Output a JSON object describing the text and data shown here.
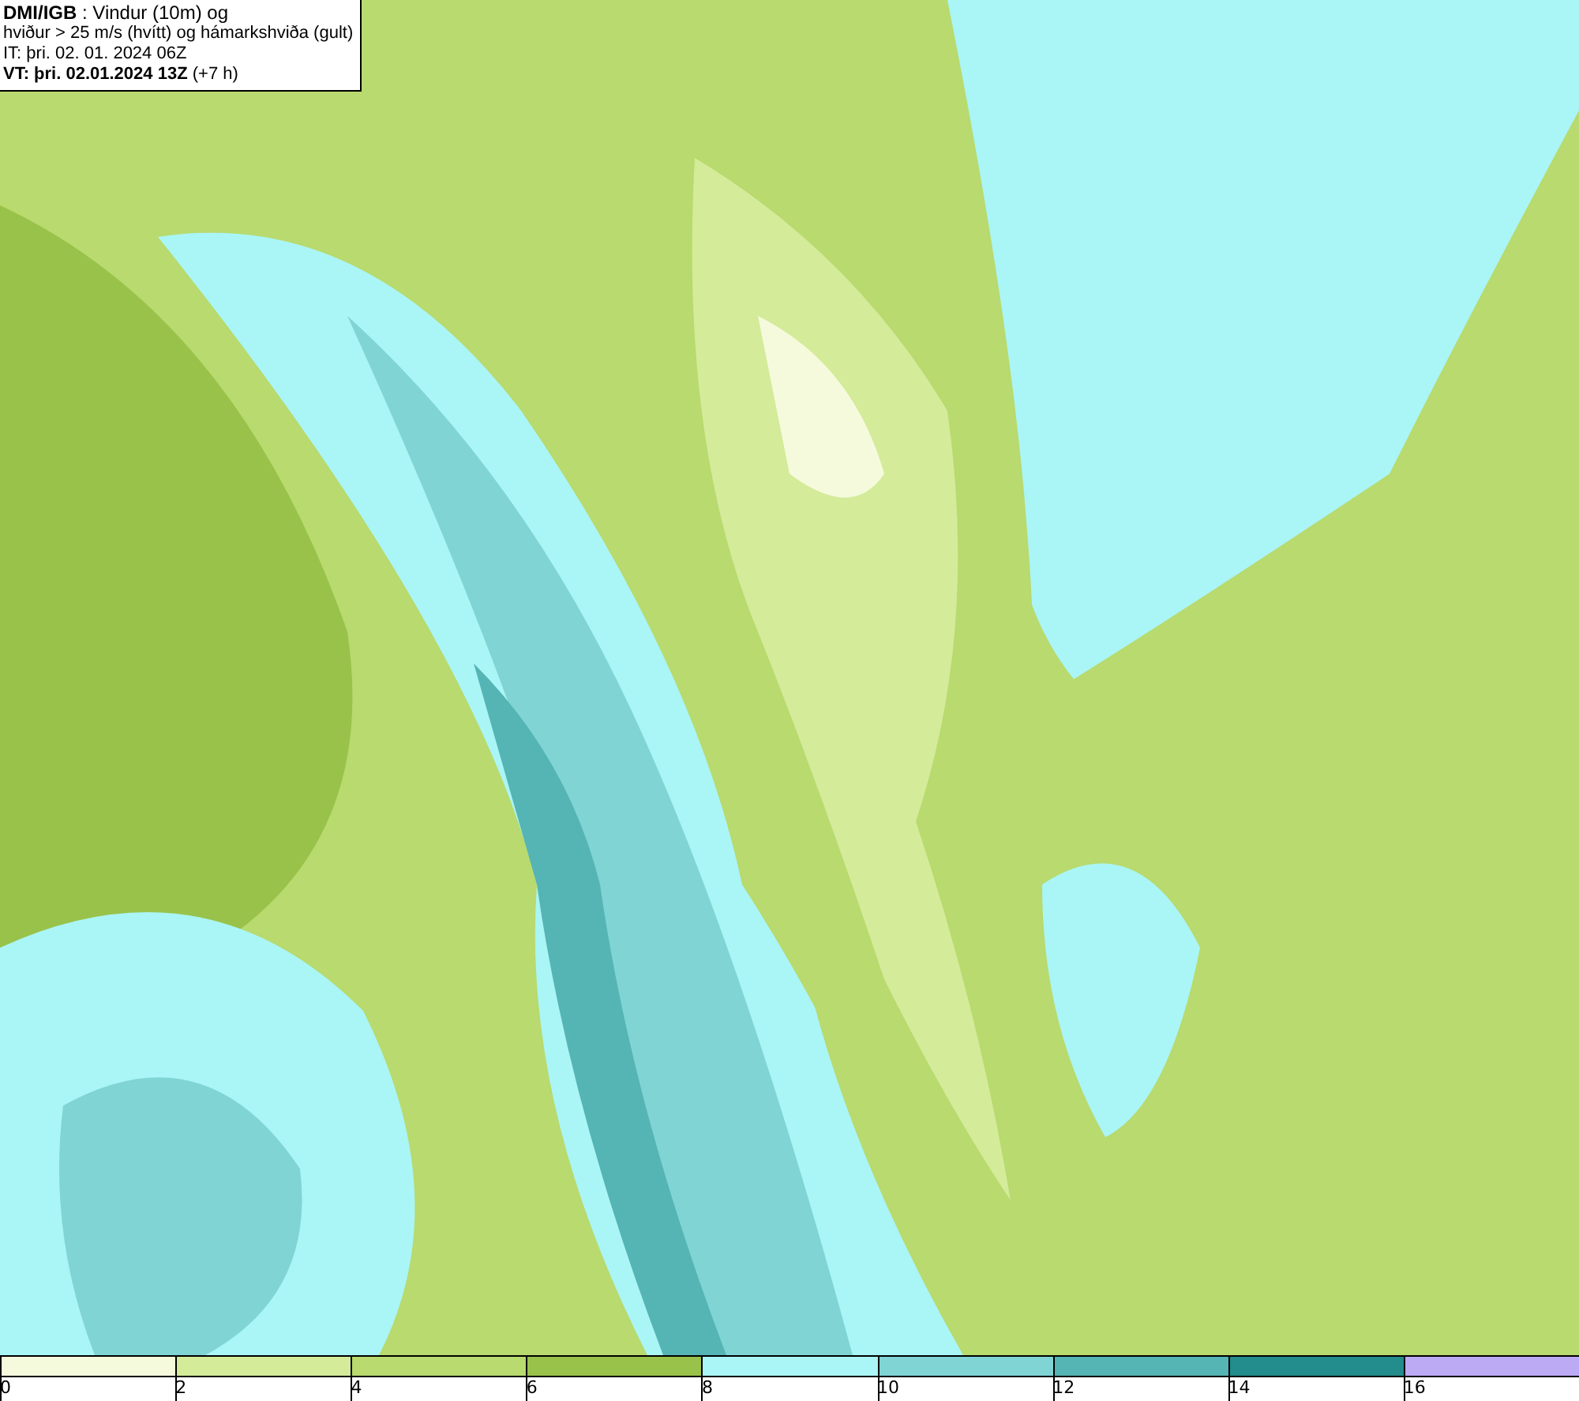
{
  "title_box": {
    "lines": [
      "**DMI/IGB** : Vindur (10m) og",
      "hviður > 25 m/s (hvítt) og hámarkshviða (gult)",
      "IT: þri. 02. 01. 2024 06Z",
      "**VT: þri. 02.01.2024 13Z** (+7 h)"
    ]
  },
  "legend": {
    "bins": [
      {
        "color": "#f5fadc"
      },
      {
        "color": "#d4eb9a"
      },
      {
        "color": "#b8da6e"
      },
      {
        "color": "#99c24a"
      },
      {
        "color": "#aaf5f5"
      },
      {
        "color": "#80d4d4"
      },
      {
        "color": "#55b4b4"
      },
      {
        "color": "#238c8c"
      },
      {
        "color": "#bcaaf5"
      }
    ],
    "ticks": [
      "0",
      "2",
      "4",
      "6",
      "8",
      "10",
      "12",
      "14",
      "16"
    ]
  }
}
